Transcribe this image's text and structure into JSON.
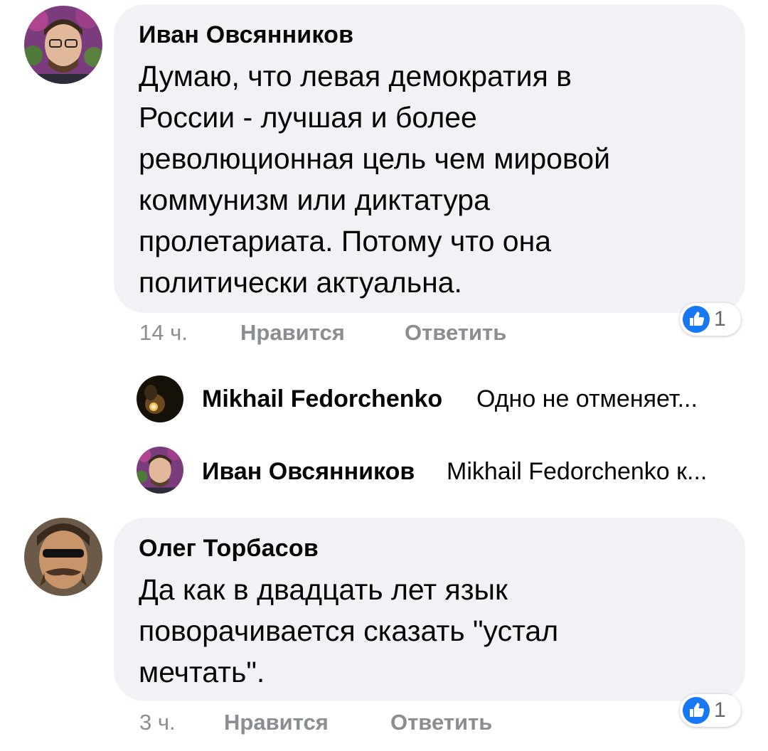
{
  "comments": [
    {
      "author": "Иван Овсянников",
      "text": "Думаю, что левая демократия в\nРоссии - лучшая и более\nреволюционная цель чем мировой\nкоммунизм или диктатура\nпролетариата. Потому что она\nполитически актуальна.",
      "time": "14 ч.",
      "like_label": "Нравится",
      "reply_label": "Ответить",
      "reaction_count": "1",
      "replies": [
        {
          "author": "Mikhail Fedorchenko",
          "snippet": "Одно не отменяет..."
        },
        {
          "author": "Иван Овсянников",
          "snippet": "Mikhail Fedorchenko к..."
        }
      ]
    },
    {
      "author": "Олег Торбасов",
      "text": "Да как в двадцать лет язык\nповорачивается сказать \"устал\nмечтать\".",
      "time": "3 ч.",
      "like_label": "Нравится",
      "reply_label": "Ответить",
      "reaction_count": "1"
    }
  ],
  "colors": {
    "bubble": "#f0f2f5",
    "meta_text": "#8a8d91",
    "like_blue": "#1877f2"
  },
  "icons": [
    "like-icon",
    "avatar"
  ]
}
